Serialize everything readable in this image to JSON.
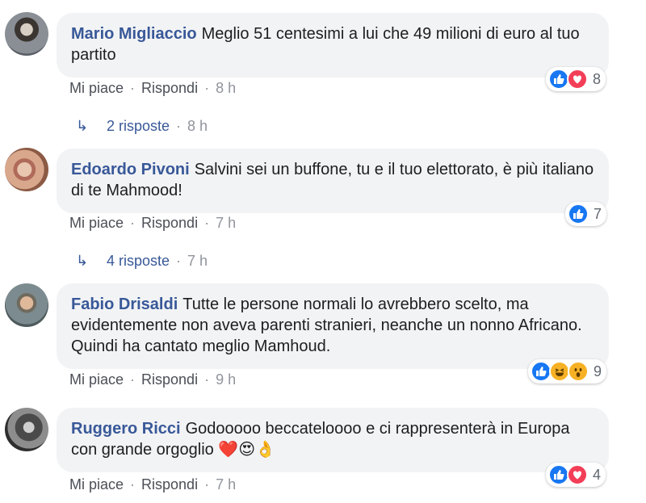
{
  "comments": [
    {
      "author": "Mario Migliaccio",
      "text": "Meglio 51 centesimi a lui che 49 milioni di euro al tuo partito",
      "like_label": "Mi piace",
      "reply_label": "Rispondi",
      "time": "8 h",
      "reaction_icons": [
        "like-icon",
        "love-icon"
      ],
      "reaction_count": "8",
      "replies": {
        "label": "2 risposte",
        "time": "8 h"
      }
    },
    {
      "author": "Edoardo Pivoni",
      "text": "Salvini sei un buffone, tu e il tuo elettorato, è più italiano di te Mahmood!",
      "like_label": "Mi piace",
      "reply_label": "Rispondi",
      "time": "7 h",
      "reaction_icons": [
        "like-icon"
      ],
      "reaction_count": "7",
      "replies": {
        "label": "4 risposte",
        "time": "7 h"
      }
    },
    {
      "author": "Fabio Drisaldi",
      "text": "Tutte le persone normali lo avrebbero scelto, ma evidentemente non aveva parenti stranieri, neanche un nonno Africano. Quindi ha cantato meglio Mamhoud.",
      "like_label": "Mi piace",
      "reply_label": "Rispondi",
      "time": "9 h",
      "reaction_icons": [
        "like-icon",
        "haha-icon",
        "wow-icon"
      ],
      "reaction_count": "9"
    },
    {
      "author": "Ruggero Ricci",
      "text": "Godooooo beccateloooo e ci rappresenterà in Europa con grande orgoglio ",
      "emoji": "❤️😍👌",
      "like_label": "Mi piace",
      "reply_label": "Rispondi",
      "time": "7 h",
      "reaction_icons": [
        "like-icon",
        "love-icon"
      ],
      "reaction_count": "4"
    }
  ],
  "colors": {
    "author": "#385898",
    "bubble": "#f2f3f5",
    "like": "#1877f2",
    "love": "#f33e58",
    "haha": "#f7b125"
  }
}
